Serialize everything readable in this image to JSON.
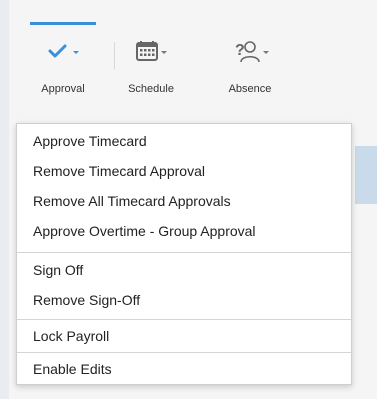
{
  "toolbar": {
    "approval_label": "Approval",
    "schedule_label": "Schedule",
    "absence_label": "Absence"
  },
  "menu": {
    "groups": [
      [
        "Approve Timecard",
        "Remove Timecard Approval",
        "Remove All Timecard Approvals",
        "Approve Overtime - Group Approval"
      ],
      [
        "Sign Off",
        "Remove Sign-Off"
      ],
      [
        "Lock Payroll"
      ],
      [
        "Enable Edits"
      ]
    ]
  },
  "colors": {
    "accent": "#3a8fd9",
    "icon_gray": "#666666",
    "menu_text": "#222222"
  }
}
